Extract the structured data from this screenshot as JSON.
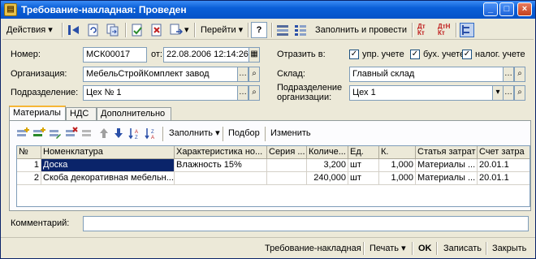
{
  "window": {
    "title": "Требование-накладная: Проведен"
  },
  "toolbar": {
    "actions_label": "Действия",
    "goto_label": "Перейти",
    "help_label": "?",
    "fill_post_label": "Заполнить и провести",
    "dt_kt_label": "Дт Кт",
    "dtn_kt_label": "ДтН Кт"
  },
  "header": {
    "number_label": "Номер:",
    "number_value": "МСК00017",
    "date_label": "от:",
    "date_value": "22.08.2006 12:14:26",
    "org_label": "Организация:",
    "org_value": "МебельСтройКомплект завод",
    "dept_label": "Подразделение:",
    "dept_value": "Цех № 1",
    "reflect_label": "Отразить в:",
    "upr_label": "упр. учете",
    "buh_label": "бух. учете",
    "nal_label": "налог. учете",
    "warehouse_label": "Склад:",
    "warehouse_value": "Главный склад",
    "org_dept_label_1": "Подразделение",
    "org_dept_label_2": "организации:",
    "org_dept_value": "Цех 1"
  },
  "tabs": [
    {
      "label": "Материалы"
    },
    {
      "label": "НДС"
    },
    {
      "label": "Дополнительно"
    }
  ],
  "grid_toolbar": {
    "fill_label": "Заполнить",
    "select_label": "Подбор",
    "change_label": "Изменить"
  },
  "table": {
    "columns": [
      "№",
      "Номенклатура",
      "Характеристика но...",
      "Серия ...",
      "Количе...",
      "Ед.",
      "К.",
      "Статья затрат",
      "Счет затра"
    ],
    "rows": [
      [
        "1",
        "Доска",
        "Влажность 15%",
        "",
        "3,200",
        "шт",
        "1,000",
        "Материалы ...",
        "20.01.1"
      ],
      [
        "2",
        "Скоба декоративная мебельн...",
        "",
        "",
        "240,000",
        "шт",
        "1,000",
        "Материалы ...",
        "20.01.1"
      ]
    ]
  },
  "comment": {
    "label": "Комментарий:",
    "value": ""
  },
  "bottom": {
    "invoice_label": "Требование-накладная",
    "print_label": "Печать",
    "ok_label": "OK",
    "save_label": "Записать",
    "close_label": "Закрыть"
  },
  "colors": {
    "title_blue": "#0553c8",
    "selection": "#0a246a",
    "tab_accent": "#f6b636"
  }
}
